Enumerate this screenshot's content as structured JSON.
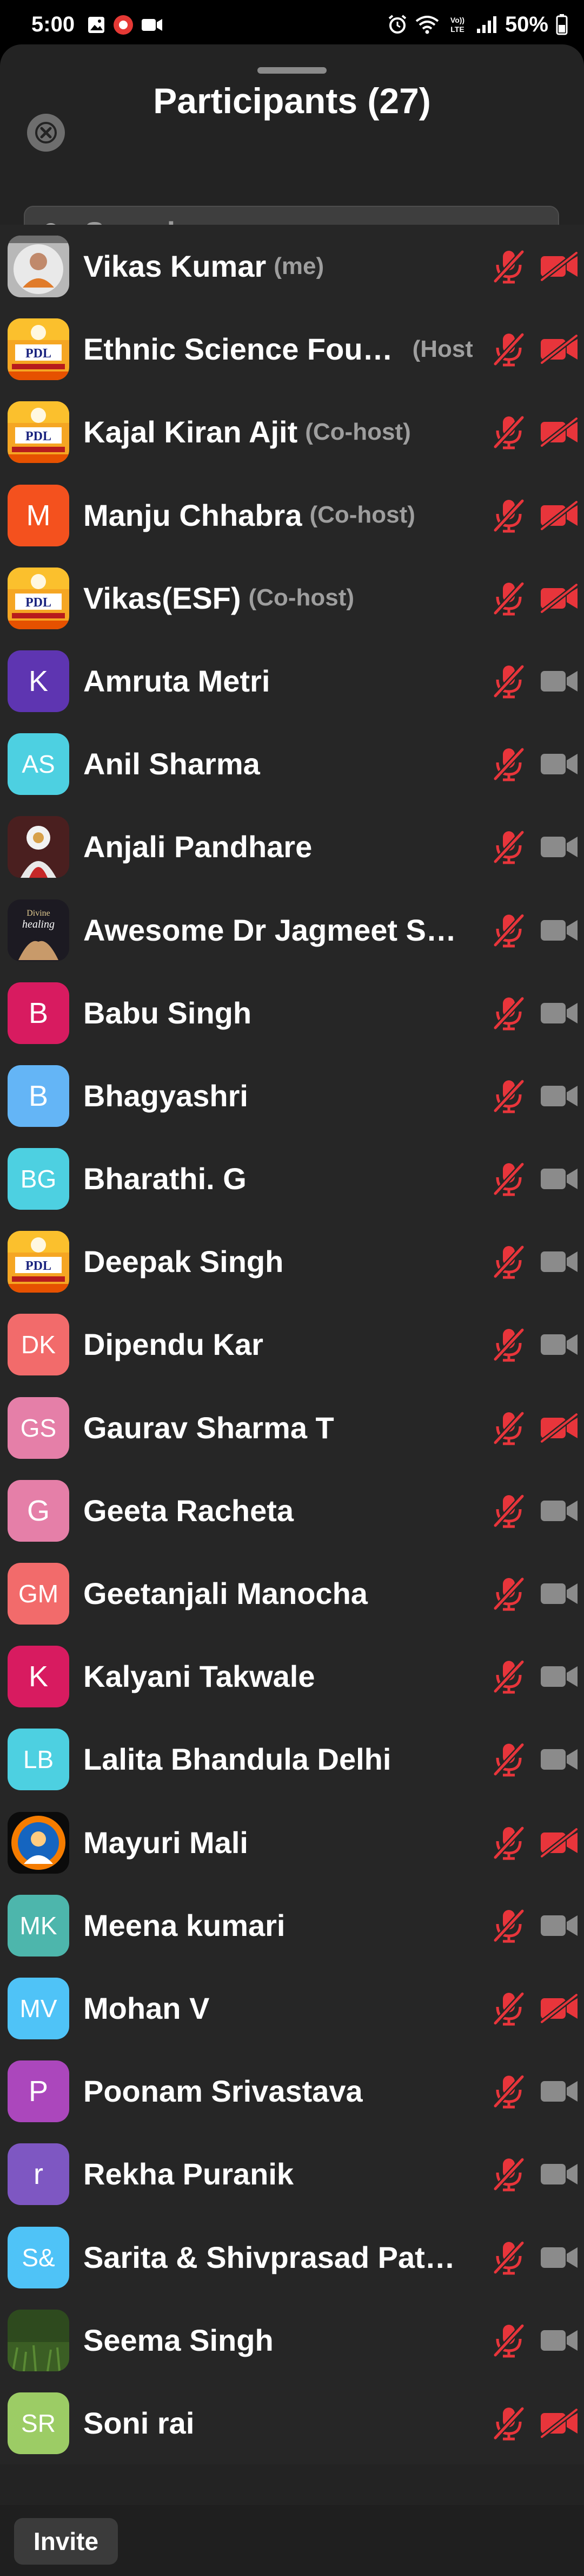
{
  "status_bar": {
    "time": "5:00",
    "battery": "50%",
    "network_label": "VoLTE"
  },
  "sheet": {
    "title": "Participants (27)",
    "search_placeholder": "Search",
    "invite_label": "Invite"
  },
  "colors": {
    "sheet_bg": "#232323",
    "muted_red": "#e8353b",
    "video_gray": "#8b8b8b"
  },
  "participants": [
    {
      "name": "Vikas Kumar",
      "role": "(me)",
      "avatar": "photo-speaker",
      "mic": "muted",
      "video": "off"
    },
    {
      "name": "Ethnic Science Fou…",
      "role": "(Host)",
      "avatar": "photo-logo",
      "mic": "muted",
      "video": "off"
    },
    {
      "name": "Kajal Kiran Ajit",
      "role": "(Co-host)",
      "avatar": "photo-logo",
      "mic": "muted",
      "video": "off"
    },
    {
      "name": "Manju Chhabra",
      "role": "(Co-host)",
      "avatar_initials": "M",
      "avatar_color": "#f4511e",
      "mic": "muted",
      "video": "off"
    },
    {
      "name": "Vikas(ESF)",
      "role": "(Co-host)",
      "avatar": "photo-logo",
      "mic": "muted",
      "video": "off"
    },
    {
      "name": "Amruta Metri",
      "role": "",
      "avatar_initials": "K",
      "avatar_color": "#5e35b1",
      "mic": "muted",
      "video": "available"
    },
    {
      "name": "Anil Sharma",
      "role": "",
      "avatar_initials": "AS",
      "avatar_color": "#4dd0e1",
      "mic": "muted",
      "video": "available"
    },
    {
      "name": "Anjali Pandhare",
      "role": "",
      "avatar": "photo-deity",
      "mic": "muted",
      "video": "available"
    },
    {
      "name": "Awesome Dr Jagmeet S…",
      "role": "",
      "avatar": "photo-healing",
      "mic": "muted",
      "video": "available"
    },
    {
      "name": "Babu Singh",
      "role": "",
      "avatar_initials": "B",
      "avatar_color": "#d81b60",
      "mic": "muted",
      "video": "available"
    },
    {
      "name": "Bhagyashri",
      "role": "",
      "avatar_initials": "B",
      "avatar_color": "#64b5f6",
      "mic": "muted",
      "video": "available"
    },
    {
      "name": "Bharathi. G",
      "role": "",
      "avatar_initials": "BG",
      "avatar_color": "#4dd0e1",
      "mic": "muted",
      "video": "available"
    },
    {
      "name": "Deepak Singh",
      "role": "",
      "avatar": "photo-logo",
      "mic": "muted",
      "video": "available"
    },
    {
      "name": "Dipendu Kar",
      "role": "",
      "avatar_initials": "DK",
      "avatar_color": "#f26b6b",
      "mic": "muted",
      "video": "available"
    },
    {
      "name": "Gaurav Sharma T",
      "role": "",
      "avatar_initials": "GS",
      "avatar_color": "#e57fa8",
      "mic": "muted",
      "video": "off"
    },
    {
      "name": "Geeta  Racheta",
      "role": "",
      "avatar_initials": "G",
      "avatar_color": "#e57fa8",
      "mic": "muted",
      "video": "available"
    },
    {
      "name": "Geetanjali Manocha",
      "role": "",
      "avatar_initials": "GM",
      "avatar_color": "#f26b6b",
      "mic": "muted",
      "video": "available"
    },
    {
      "name": "Kalyani Takwale",
      "role": "",
      "avatar_initials": "K",
      "avatar_color": "#d81b60",
      "mic": "muted",
      "video": "available"
    },
    {
      "name": "Lalita Bhandula Delhi",
      "role": "",
      "avatar_initials": "LB",
      "avatar_color": "#4dd0e1",
      "mic": "muted",
      "video": "available"
    },
    {
      "name": "Mayuri Mali",
      "role": "",
      "avatar": "photo-guru",
      "mic": "muted",
      "video": "off"
    },
    {
      "name": "Meena kumari",
      "role": "",
      "avatar_initials": "MK",
      "avatar_color": "#4db6ac",
      "mic": "muted",
      "video": "available"
    },
    {
      "name": "Mohan V",
      "role": "",
      "avatar_initials": "MV",
      "avatar_color": "#4fc3f7",
      "mic": "muted",
      "video": "off"
    },
    {
      "name": "Poonam Srivastava",
      "role": "",
      "avatar_initials": "P",
      "avatar_color": "#ab47bc",
      "mic": "muted",
      "video": "available"
    },
    {
      "name": "Rekha Puranik",
      "role": "",
      "avatar_initials": "r",
      "avatar_color": "#7e57c2",
      "mic": "muted",
      "video": "available"
    },
    {
      "name": "Sarita & Shivprasad Pat…",
      "role": "",
      "avatar_initials": "S&",
      "avatar_color": "#4fc3f7",
      "mic": "muted",
      "video": "available"
    },
    {
      "name": "Seema Singh",
      "role": "",
      "avatar": "photo-grass",
      "mic": "muted",
      "video": "available"
    },
    {
      "name": "Soni rai",
      "role": "",
      "avatar_initials": "SR",
      "avatar_color": "#9ccc65",
      "mic": "muted",
      "video": "off"
    }
  ]
}
